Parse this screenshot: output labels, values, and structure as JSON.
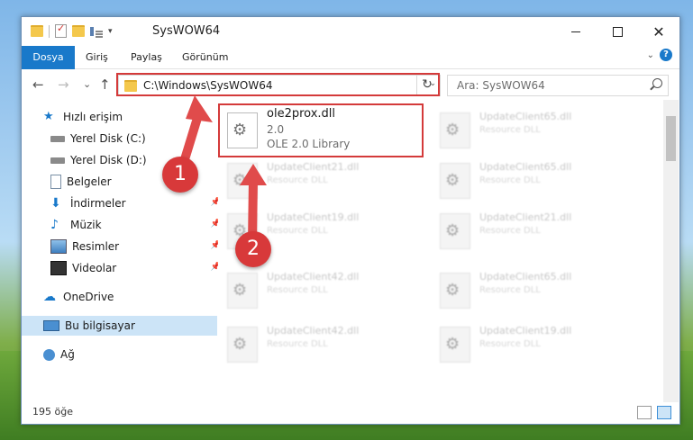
{
  "window": {
    "title": "SysWOW64",
    "controls": {
      "minimize": "minimize-icon",
      "maximize": "maximize-icon",
      "close": "✕"
    }
  },
  "ribbon": {
    "tabs": [
      "Dosya",
      "Giriş",
      "Paylaş",
      "Görünüm"
    ],
    "help": "?"
  },
  "nav": {
    "back": "←",
    "forward": "→",
    "recent": "⌄",
    "up": "↑",
    "address": "C:\\Windows\\SysWOW64",
    "refresh": "↻",
    "search_placeholder": "Ara: SysWOW64"
  },
  "sidebar": {
    "items": [
      {
        "label": "Hızlı erişim",
        "icon": "star-icon"
      },
      {
        "label": "Yerel Disk (C:)",
        "icon": "drive-icon"
      },
      {
        "label": "Yerel Disk (D:)",
        "icon": "drive-icon"
      },
      {
        "label": "Belgeler",
        "icon": "documents-icon"
      },
      {
        "label": "İndirmeler",
        "icon": "downloads-icon"
      },
      {
        "label": "Müzik",
        "icon": "music-icon"
      },
      {
        "label": "Resimler",
        "icon": "pictures-icon"
      },
      {
        "label": "Videolar",
        "icon": "videos-icon"
      },
      {
        "label": "OneDrive",
        "icon": "cloud-icon"
      },
      {
        "label": "Bu bilgisayar",
        "icon": "computer-icon"
      },
      {
        "label": "Ağ",
        "icon": "network-icon"
      }
    ]
  },
  "files": {
    "main": {
      "name": "ole2prox.dll",
      "version": "2.0",
      "desc": "OLE 2.0 Library"
    },
    "blurred": [
      {
        "name": "UpdateClient65.dll",
        "desc": "Resource DLL"
      },
      {
        "name": "UpdateClient21.dll",
        "desc": "Resource DLL"
      },
      {
        "name": "UpdateClient65.dll",
        "desc": "Resource DLL"
      },
      {
        "name": "UpdateClient19.dll",
        "desc": "Resource DLL"
      },
      {
        "name": "UpdateClient21.dll",
        "desc": "Resource DLL"
      },
      {
        "name": "UpdateClient42.dll",
        "desc": "Resource DLL"
      },
      {
        "name": "UpdateClient65.dll",
        "desc": "Resource DLL"
      },
      {
        "name": "UpdateClient42.dll",
        "desc": "Resource DLL"
      },
      {
        "name": "UpdateClient19.dll",
        "desc": "Resource DLL"
      }
    ]
  },
  "status": {
    "count": "195 öğe"
  },
  "annotations": {
    "step1": "1",
    "step2": "2",
    "color": "#d8393a"
  }
}
